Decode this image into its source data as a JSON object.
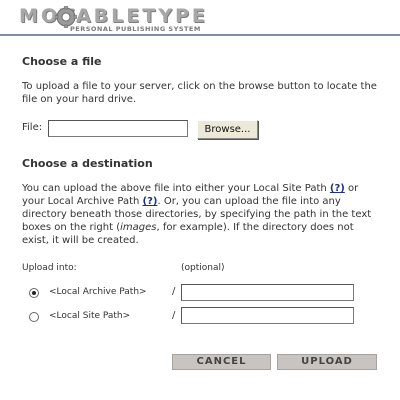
{
  "header": {
    "logo_text": "MOVABLETYPE",
    "tagline": "PERSONAL PUBLISHING SYSTEM"
  },
  "choose_file": {
    "title": "Choose a file",
    "intro": "To upload a file to your server, click on the browse button to locate the file on your hard drive.",
    "file_label": "File:",
    "file_value": "",
    "browse_label": "Browse..."
  },
  "choose_destination": {
    "title": "Choose a destination",
    "p_part1": "You can upload the above file into either your Local Site Path ",
    "help1": "(?)",
    "p_part2": " or your Local Archive Path ",
    "help2": "(?)",
    "p_part3": ". Or, you can upload the file into any directory beneath those directories, by specifying the path in the text boxes on the right (",
    "p_italic": "images",
    "p_part4": ", for example). If the directory does not exist, it will be created.",
    "upload_into_label": "Upload into:",
    "optional_label": "(optional)",
    "options": [
      {
        "label": "<Local Archive Path>",
        "selected": true,
        "separator": "/",
        "value": ""
      },
      {
        "label": "<Local Site Path>",
        "selected": false,
        "separator": "/",
        "value": ""
      }
    ]
  },
  "actions": {
    "cancel_label": "CANCEL",
    "upload_label": "UPLOAD"
  }
}
